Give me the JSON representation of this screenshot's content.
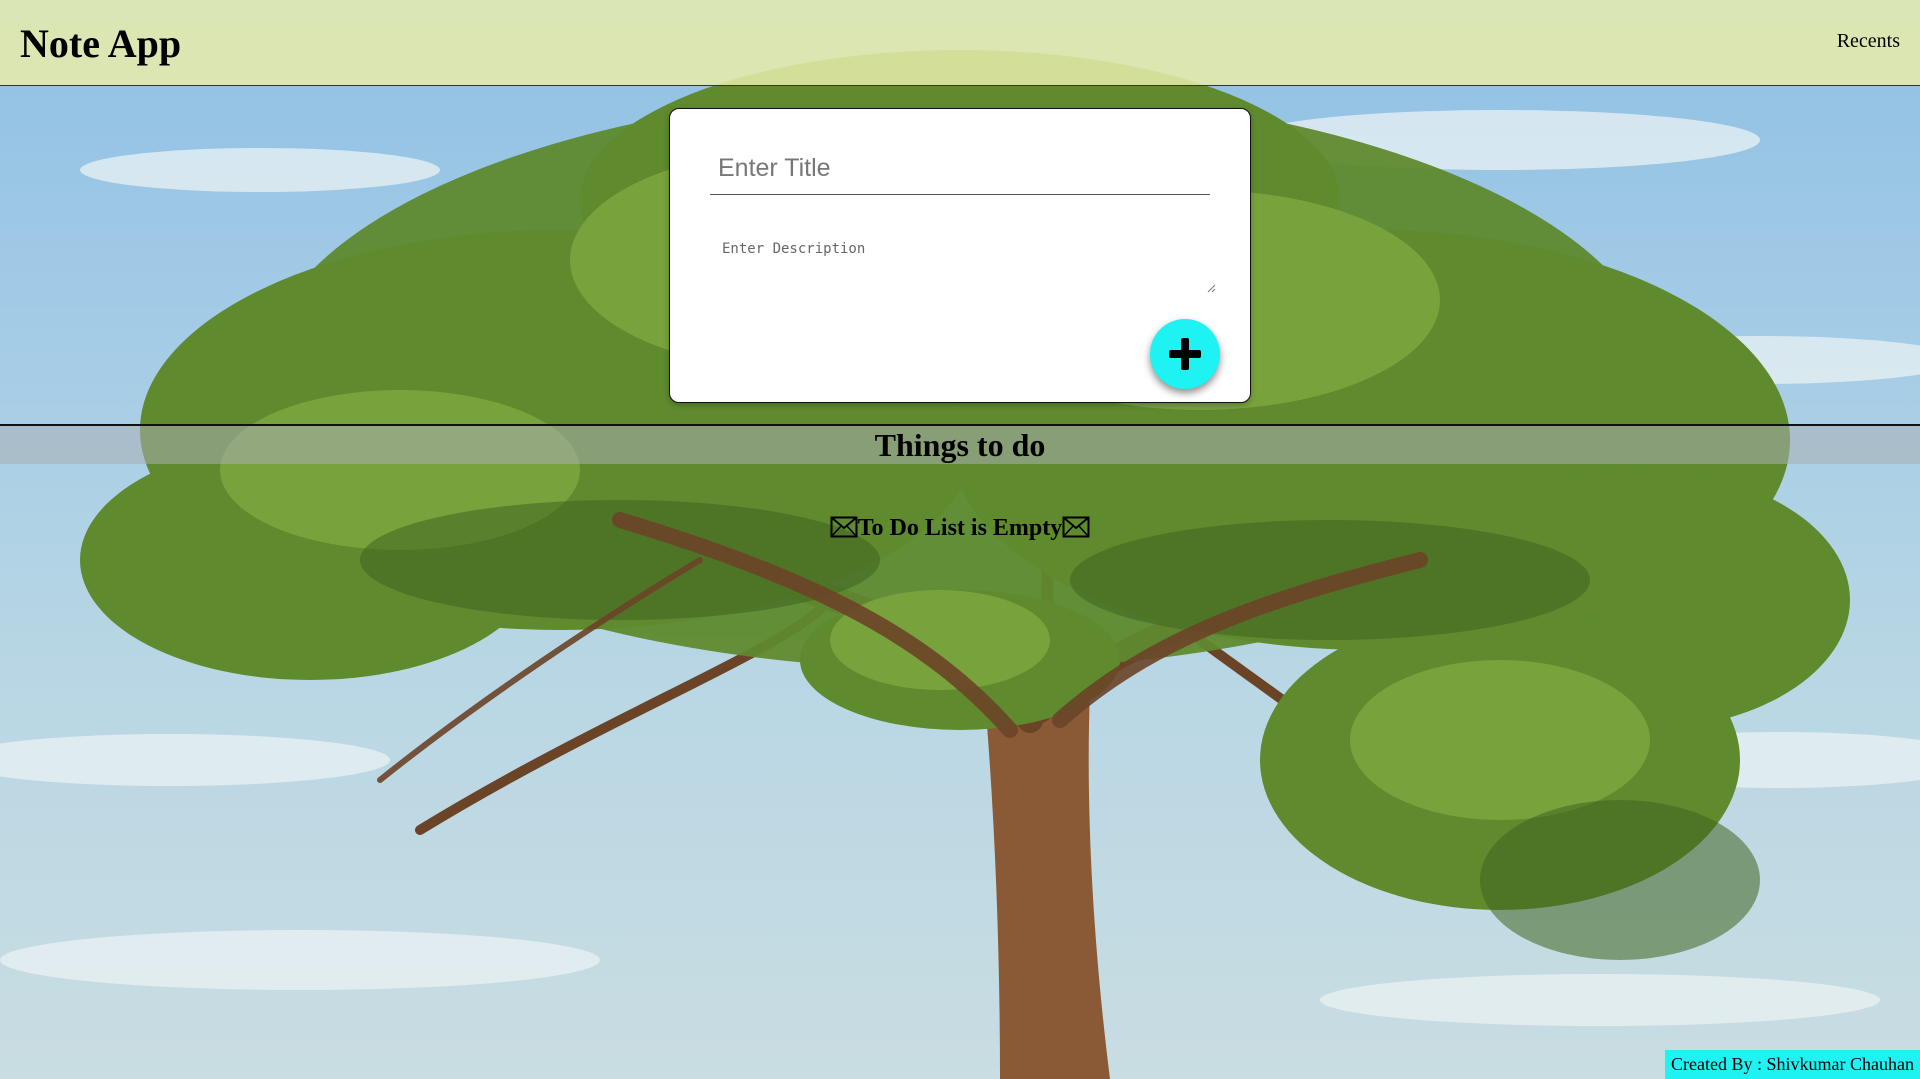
{
  "header": {
    "brand": "Note App",
    "nav_link": "Recents"
  },
  "note_form": {
    "title_placeholder": "Enter Title",
    "description_placeholder": "Enter Description",
    "add_button_icon": "plus-icon",
    "accent_color": "#1ef2f2"
  },
  "todo_section": {
    "heading": "Things to do",
    "empty_message": "To Do List is Empty",
    "empty_icon": "mail-icon"
  },
  "footer": {
    "credit": "Created By : Shivkumar Chauhan"
  },
  "background": {
    "image": "tree-landscape",
    "sky_color": "#9fc8e4",
    "foliage_color": "#5f8a2e",
    "trunk_color": "#8a5a36"
  }
}
